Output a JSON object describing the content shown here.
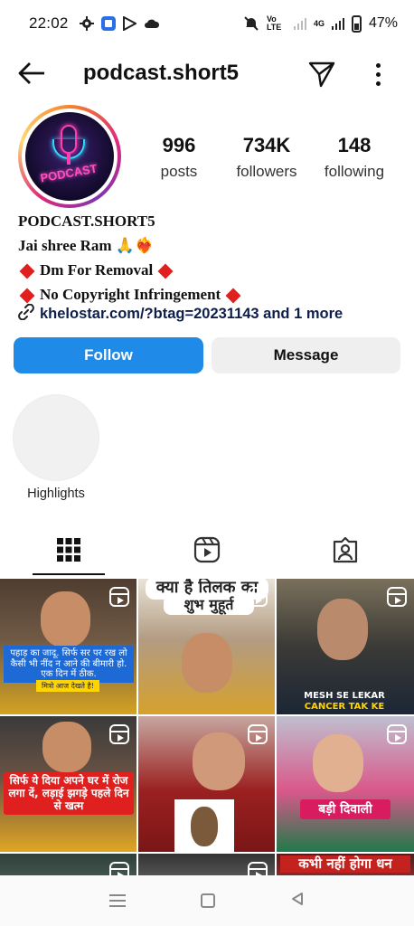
{
  "status_bar": {
    "time": "22:02",
    "network_label": "Vo LTE",
    "data_label": "4G",
    "battery": "47%"
  },
  "header": {
    "username": "podcast.short5"
  },
  "profile": {
    "avatar_text": "PODCAST",
    "stats": [
      {
        "value": "996",
        "label": "posts"
      },
      {
        "value": "734K",
        "label": "followers"
      },
      {
        "value": "148",
        "label": "following"
      }
    ],
    "name": "PODCAST.SHORT5",
    "bio_line1": "Jai shree Ram 🙏❤️‍🔥",
    "bio_line2": "Dm For Removal",
    "bio_line3": "No Copyright Infringement",
    "link": "khelostar.com/?btag=20231143 and 1 more"
  },
  "actions": {
    "follow": "Follow",
    "message": "Message"
  },
  "highlights": {
    "label": "Highlights"
  },
  "grid": {
    "posts": [
      {
        "caption": "पहाड़ का जादू. सिर्फ सर पर रख लो कैसी भी नींद न आने की बीमारी हो. एक दिन में ठीक.",
        "sub": "मित्रो आज देखते है!"
      },
      {
        "caption": "क्या है तिलक का",
        "sub": "शुभ मुहूर्त"
      },
      {
        "caption": "MESH SE LEKAR",
        "sub": "CANCER TAK KE"
      },
      {
        "caption": "सिर्फ ये दिया अपने घर में रोज लगा दें, लड़ाई झगड़े पहले दिन से खत्म"
      },
      {
        "caption": ""
      },
      {
        "caption": "बड़ी दिवाली"
      },
      {
        "caption": ""
      },
      {
        "caption": ""
      },
      {
        "caption": "कभी नहीं होगा धन"
      }
    ]
  },
  "colors": {
    "follow_blue": "#1f8ae8",
    "message_gray": "#efefef"
  }
}
